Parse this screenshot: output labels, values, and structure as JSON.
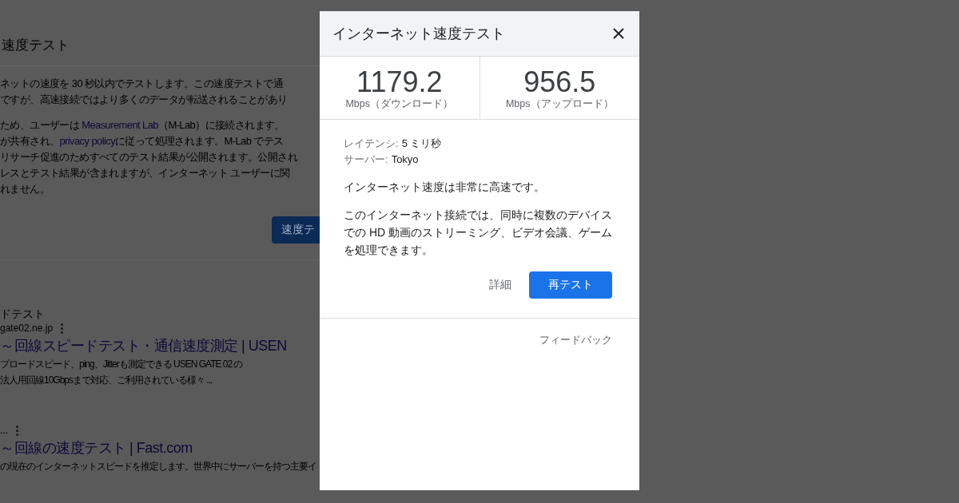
{
  "background_page": {
    "heading": "速度テスト",
    "intro_lines": [
      "ネットの速度を 30 秒以内でテストします。この速度テストで通",
      "ですが、高速接続ではより多くのデータが転送されることがあり"
    ],
    "privacy_lines": [
      [
        {
          "kind": "text",
          "text": "ため、ユーザーは "
        },
        {
          "kind": "link",
          "text": "Measurement Lab"
        },
        {
          "kind": "text",
          "text": "（M-Lab）に接続されます。"
        }
      ],
      [
        {
          "kind": "text",
          "text": "が共有され、"
        },
        {
          "kind": "link",
          "text": "privacy policy"
        },
        {
          "kind": "text",
          "text": "に従って処理されます。M-Lab でテス"
        }
      ],
      [
        {
          "kind": "text",
          "text": "リサーチ促進のためすべてのテスト結果が公開されます。公開され"
        }
      ],
      [
        {
          "kind": "text",
          "text": "レスとテスト結果が含まれますが、インターネット ユーザーに関"
        }
      ],
      [
        {
          "kind": "text",
          "text": "れません。"
        }
      ]
    ],
    "start_button": "速度テ",
    "results": [
      {
        "site_name": "ドテスト",
        "url": "gate02.ne.jp",
        "title": "～回線スピードテスト・通信速度測定 | USEN",
        "snippet_lines": [
          "プロードスピード、ping、Jitterも測定できる USEN GATE 02 の",
          "法人用回線10Gbpsまで対応、ご利用されている様々 ..."
        ]
      },
      {
        "url": "...",
        "title": "～回線の速度テスト | Fast.com",
        "snippet_lines": [
          "の現在のインターネットスピードを推定します。世界中にサーバーを持つ主要イ"
        ]
      }
    ]
  },
  "dialog": {
    "title": "インターネット速度テスト",
    "stats": [
      {
        "value": "1179.2",
        "unit": "Mbps（ダウンロード）"
      },
      {
        "value": "956.5",
        "unit": "Mbps（アップロード）"
      }
    ],
    "details": [
      {
        "label": "レイテンシ:",
        "value": "5 ミリ秒"
      },
      {
        "label": "サーバー:",
        "value": "Tokyo"
      }
    ],
    "summary": "インターネット速度は非常に高速です。",
    "description": "このインターネット接続では、同時に複数のデバイスでの HD 動画のストリーミング、ビデオ会議、ゲームを処理できます。",
    "buttons": [
      {
        "kind": "text",
        "label": "詳細"
      },
      {
        "kind": "primary",
        "label": "再テスト"
      }
    ],
    "feedback": "フィードバック"
  }
}
